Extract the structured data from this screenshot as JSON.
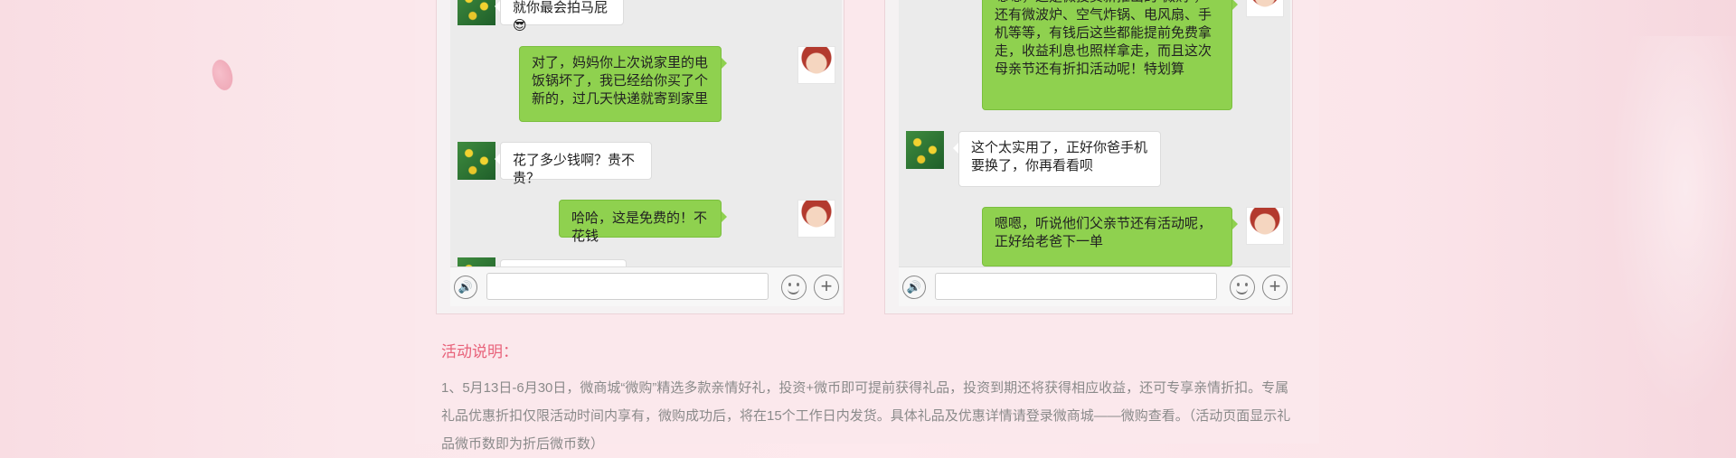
{
  "left_chat": {
    "messages": [
      {
        "side": "in",
        "text": "就你最会拍马屁😎"
      },
      {
        "side": "out",
        "text": "对了，妈妈你上次说家里的电饭锅坏了，我已经给你买了个新的，过几天快递就寄到家里"
      },
      {
        "side": "in",
        "text": "花了多少钱啊？贵不贵？"
      },
      {
        "side": "out",
        "text": "哈哈，这是免费的！不花钱"
      }
    ]
  },
  "right_chat": {
    "messages": [
      {
        "side": "out",
        "text": "嗯嗯，这是微投资新推出的“微购”，还有微波炉、空气炸锅、电风扇、手机等等，有钱后这些都能提前免费拿走，收益利息也照样拿走，而且这次母亲节还有折扣活动呢！特划算"
      },
      {
        "side": "in",
        "text": "这个太实用了，正好你爸手机要换了，你再看看呗"
      },
      {
        "side": "out",
        "text": "嗯嗯，听说他们父亲节还有活动呢，正好给老爸下一单"
      }
    ]
  },
  "input_bar": {
    "voice_icon": "voice-icon",
    "emoji_icon": "emoji-icon",
    "plus_icon": "plus-icon",
    "voice_glyph": "🔊",
    "plus_glyph": "+"
  },
  "section": {
    "title": "活动说明：",
    "description": "1、5月13日-6月30日，微商城“微购”精选多款亲情好礼，投资+微币即可提前获得礼品，投资到期还将获得相应收益，还可专享亲情折扣。专属礼品优惠折扣仅限活动时间内享有，微购成功后，将在15个工作日内发货。具体礼品及优惠详情请登录微商城——微购查看。（活动页面显示礼品微币数即为折后微币数）"
  },
  "colors": {
    "accent": "#e8627a",
    "bubble_out": "#8fd14f",
    "bubble_in": "#ffffff",
    "page_bg": "#fbe8ec"
  }
}
